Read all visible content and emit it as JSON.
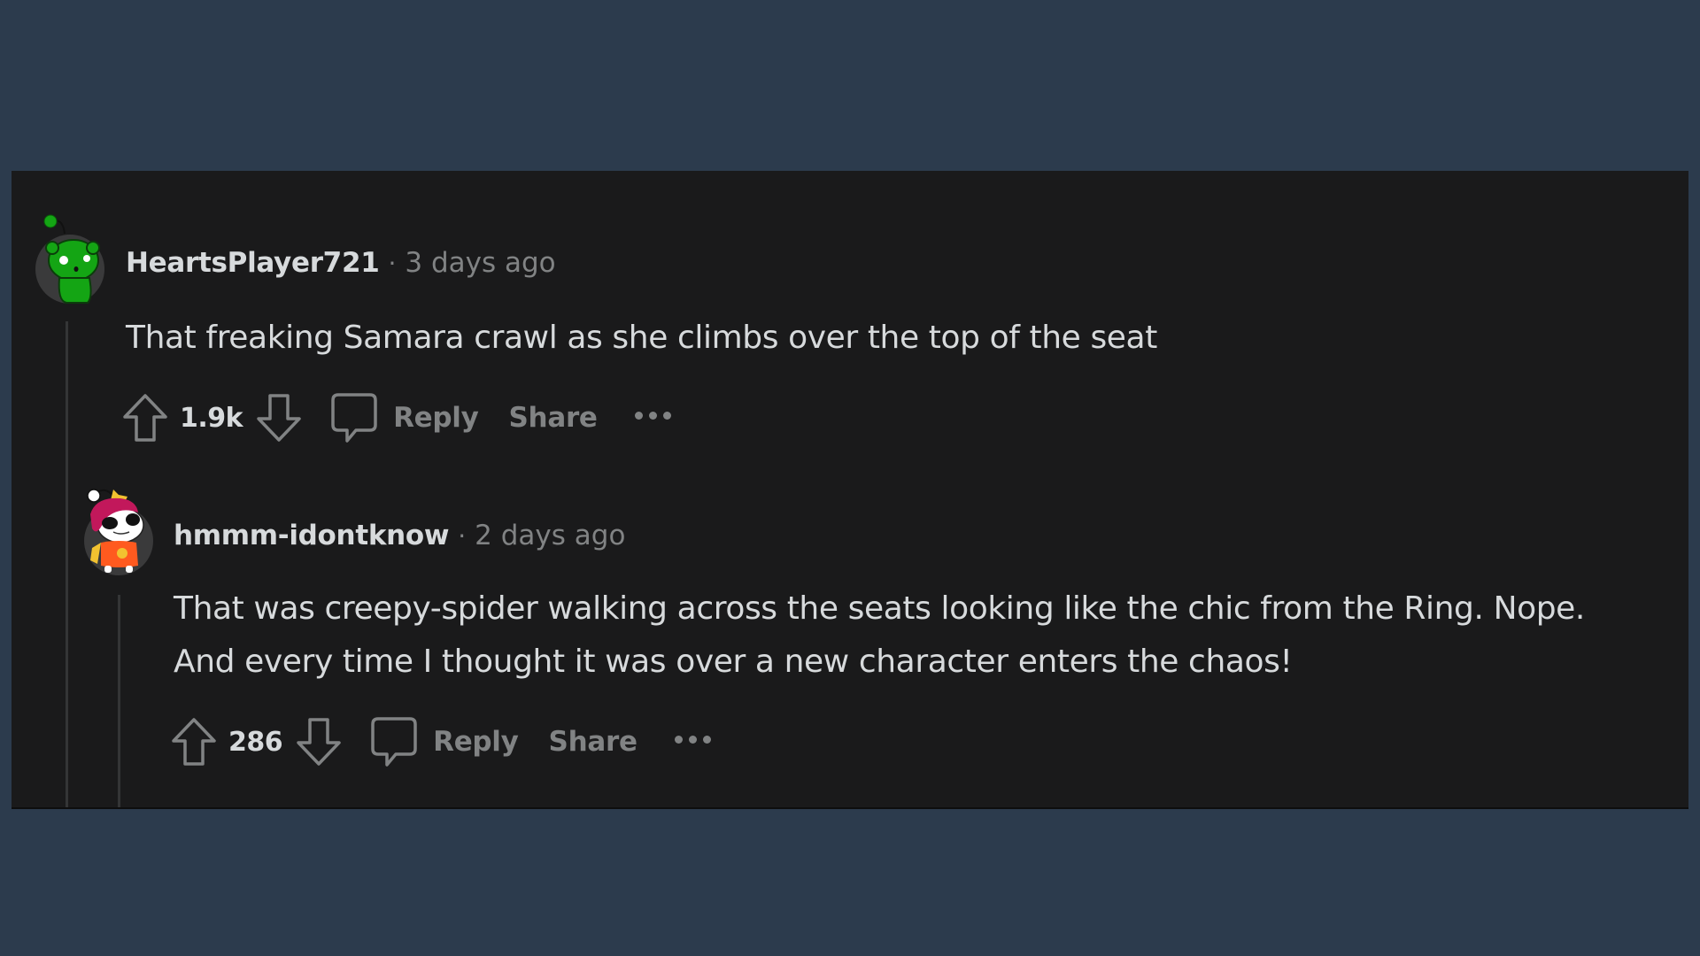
{
  "colors": {
    "page_background": "#2c3b4d",
    "panel_background": "#1a1a1b",
    "primary_text": "#d7dadc",
    "muted_text": "#818384",
    "thread_line": "#343536"
  },
  "comments": [
    {
      "username": "HeartsPlayer721",
      "separator": "·",
      "timestamp": "3 days ago",
      "avatar": "green-snoo-avatar",
      "body_lines": [
        "That freaking Samara crawl as she climbs over the top of the seat"
      ],
      "votes": "1.9k",
      "reply_label": "Reply",
      "share_label": "Share",
      "icons": [
        "upvote-icon",
        "downvote-icon",
        "comment-bubble-icon",
        "more-options-icon"
      ]
    },
    {
      "username": "hmmm-idontknow",
      "separator": "·",
      "timestamp": "2 days ago",
      "avatar": "red-hair-sunglasses-snoo-avatar",
      "body_lines": [
        "That was creepy-spider walking across the seats looking like the chic from the Ring. Nope.",
        "And every time I thought it was over a new character enters the chaos!"
      ],
      "votes": "286",
      "reply_label": "Reply",
      "share_label": "Share",
      "icons": [
        "upvote-icon",
        "downvote-icon",
        "comment-bubble-icon",
        "more-options-icon"
      ]
    }
  ]
}
